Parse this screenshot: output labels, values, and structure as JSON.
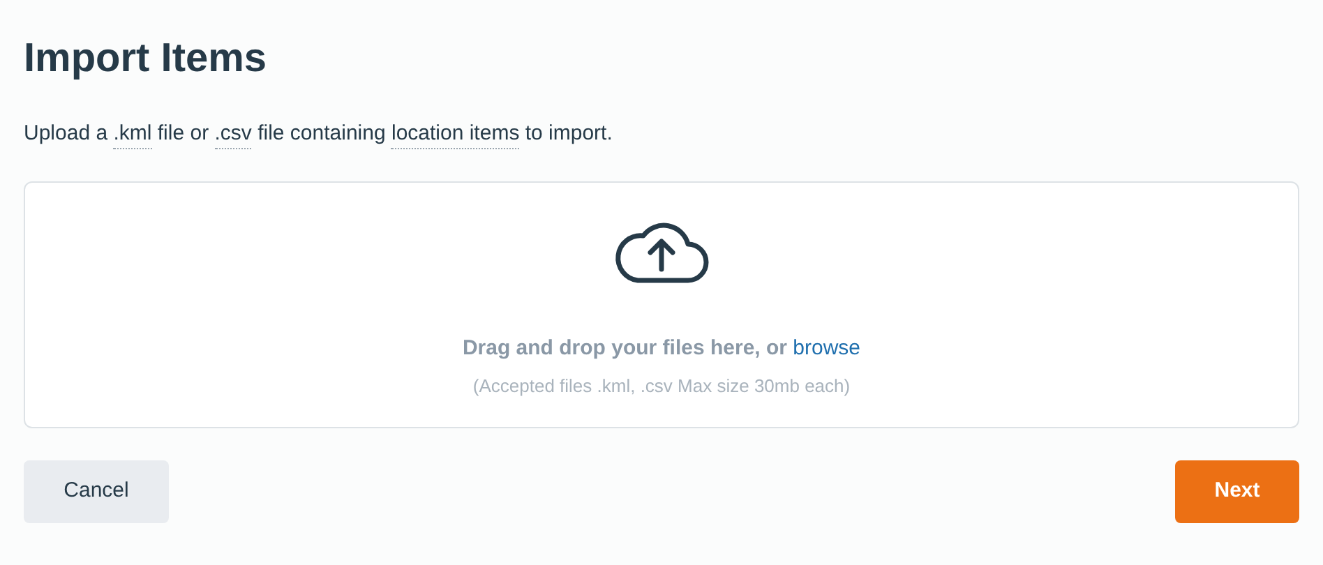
{
  "title": "Import Items",
  "intro": [
    {
      "kind": "text",
      "text": "Upload a "
    },
    {
      "kind": "term",
      "text": ".kml"
    },
    {
      "kind": "text",
      "text": " file or "
    },
    {
      "kind": "term",
      "text": ".csv"
    },
    {
      "kind": "text",
      "text": " file containing "
    },
    {
      "kind": "term",
      "text": "location items"
    },
    {
      "kind": "text",
      "text": " to import."
    }
  ],
  "dropzone": {
    "prompt": "Drag and drop your files here, or",
    "link": "browse",
    "hint": "(Accepted files .kml, .csv Max size 30mb each)"
  },
  "buttons": [
    {
      "kind": "secondary",
      "label": "Cancel"
    },
    {
      "kind": "primary",
      "label": "Next"
    }
  ]
}
